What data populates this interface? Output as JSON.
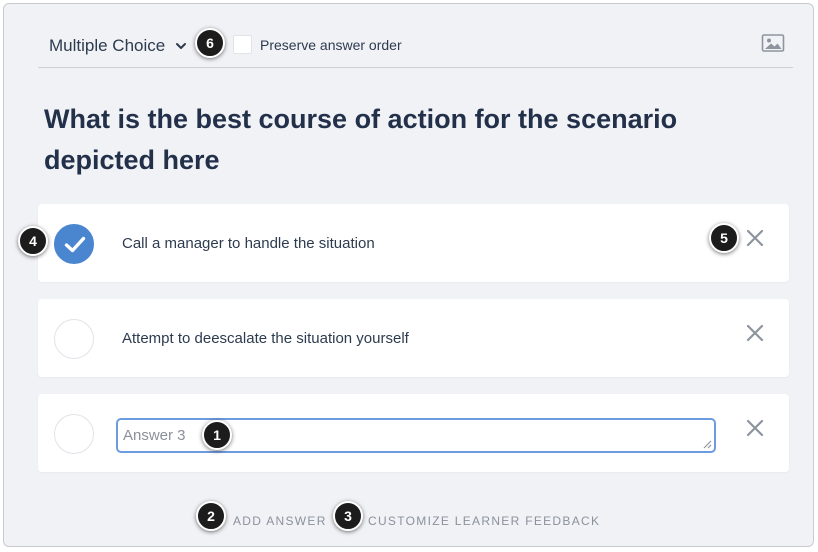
{
  "header": {
    "question_type": "Multiple Choice",
    "preserve_order_label": "Preserve answer order"
  },
  "question": {
    "text": "What is the best course of action for the scenario depicted here"
  },
  "answers": [
    {
      "text": "Call a manager to handle the situation",
      "correct": true
    },
    {
      "text": "Attempt to deescalate the situation yourself",
      "correct": false
    },
    {
      "placeholder": "Answer 3",
      "value": ""
    }
  ],
  "actions": {
    "add_answer": "ADD ANSWER",
    "customize_feedback": "CUSTOMIZE LEARNER FEEDBACK"
  },
  "callouts": {
    "c1": "1",
    "c2": "2",
    "c3": "3",
    "c4": "4",
    "c5": "5",
    "c6": "6"
  },
  "colors": {
    "accent": "#4a86cf",
    "background": "#f1f2f6",
    "text": "#22304a",
    "muted": "#8a919c"
  },
  "icons": {
    "type_dropdown": "chevron-down-icon",
    "image": "image-icon",
    "remove": "close-icon",
    "correct": "check-icon"
  }
}
